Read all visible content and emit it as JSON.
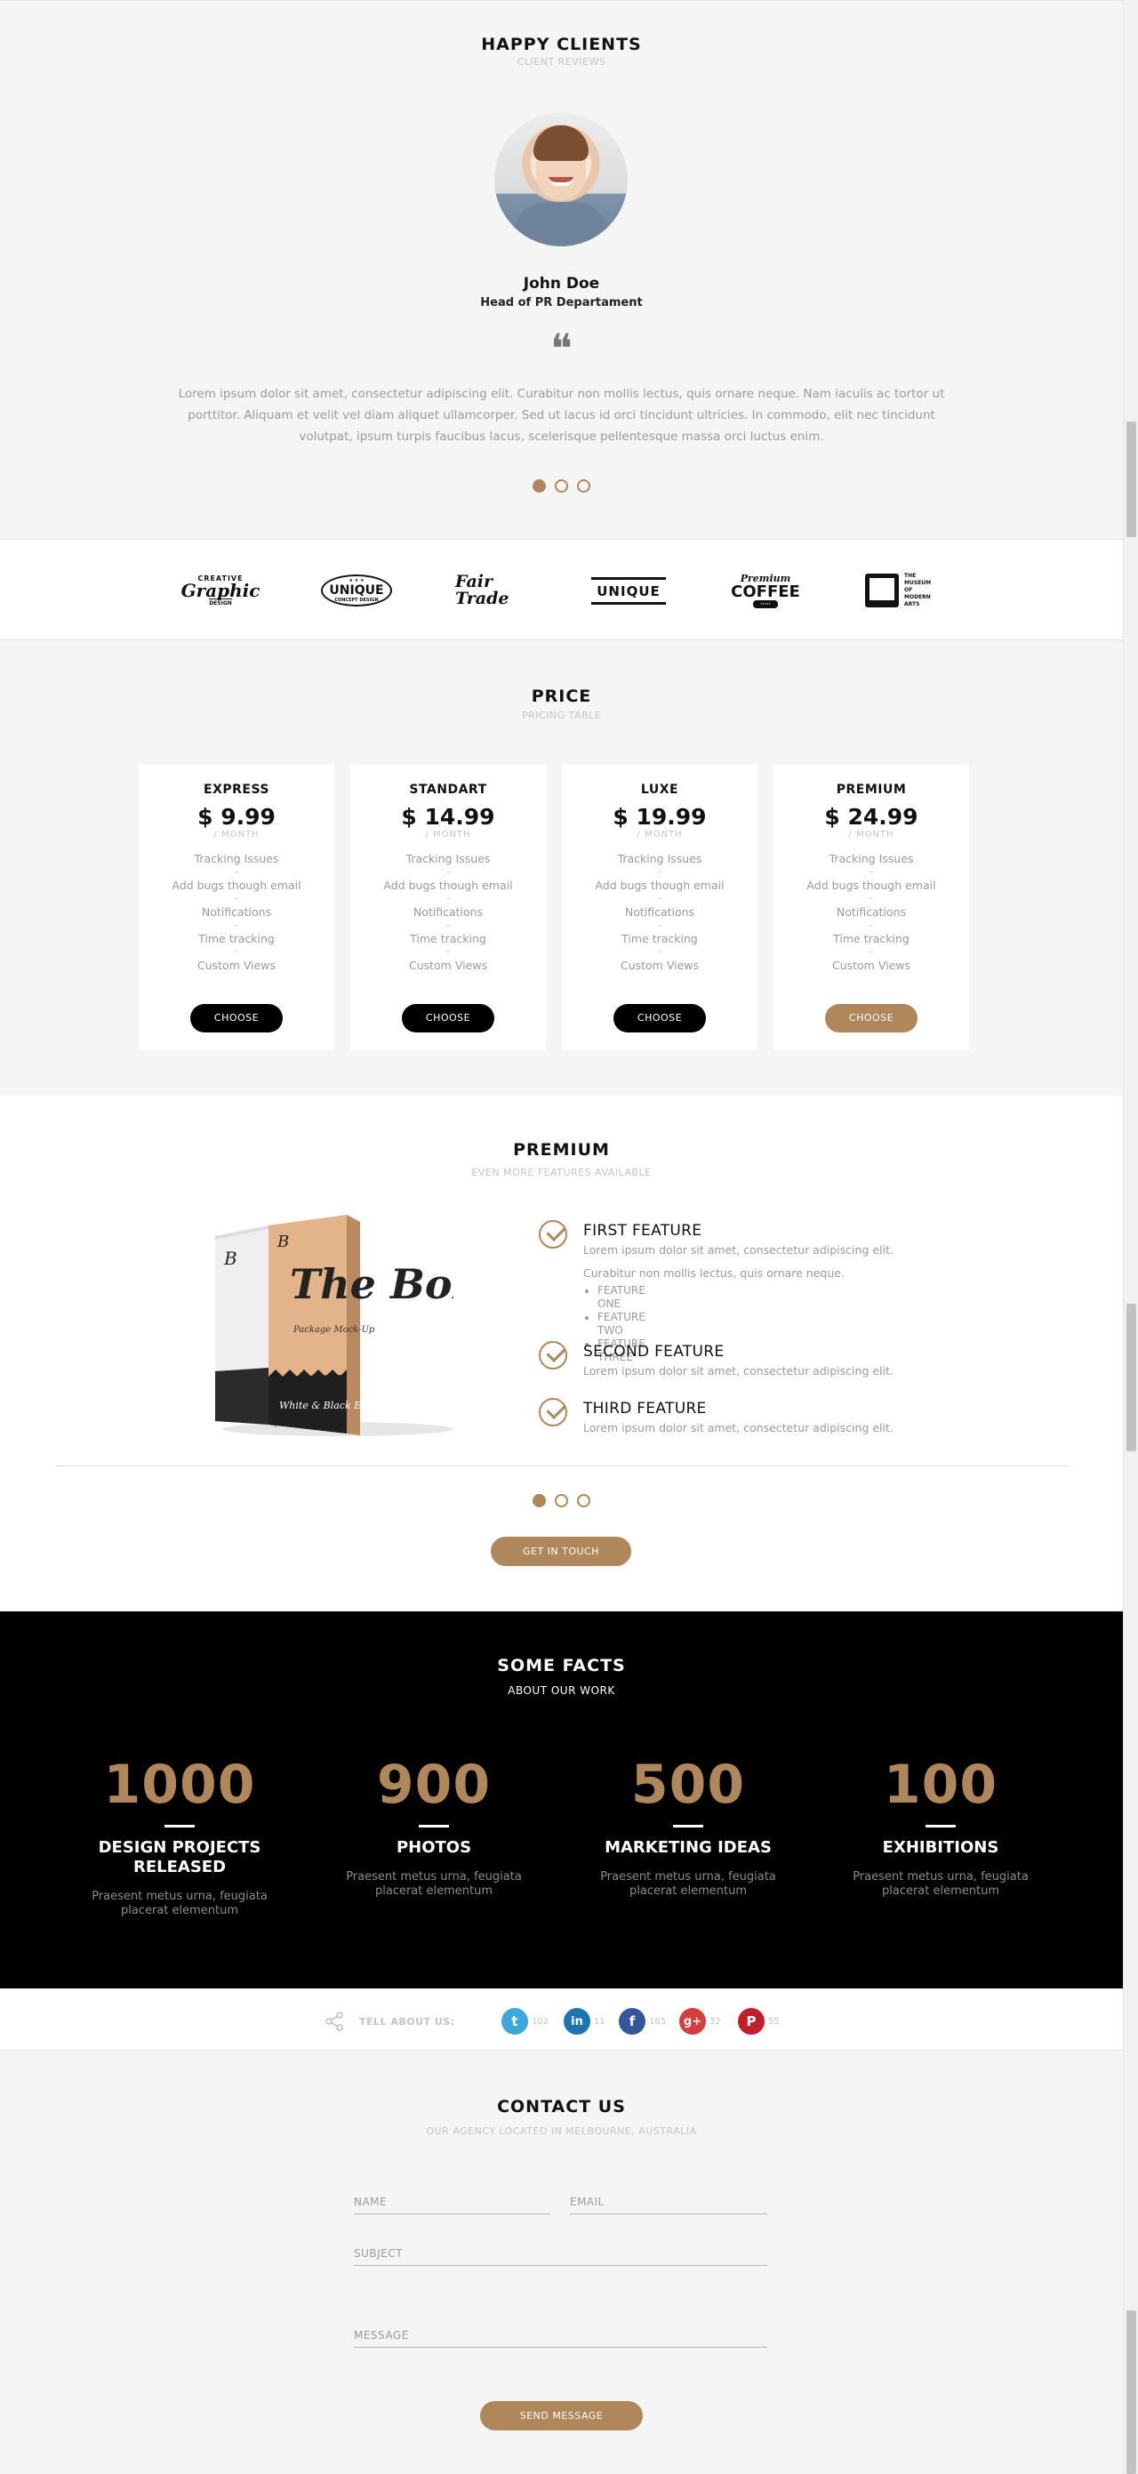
{
  "clients": {
    "title": "HAPPY CLIENTS",
    "subtitle": "CLIENT REVIEWS",
    "name": "John Doe",
    "role": "Head of PR Departament",
    "quote_mark": "❝",
    "quote": "Lorem ipsum dolor sit amet, consectetur adipiscing elit. Curabitur non mollis lectus, quis ornare neque. Nam iaculis ac tortor ut porttitor. Aliquam et velit vel diam aliquet ullamcorper. Sed ut lacus id orci tincidunt ultricies. In commodo, elit nec tincidunt volutpat, ipsum turpis faucibus lacus, scelerisque pellentesque massa orci luctus enim.",
    "slider_active": 1,
    "slider_count": 3
  },
  "logos": [
    {
      "text": "Graphic",
      "small": "CREATIVE · DESIGN"
    },
    {
      "text": "UNIQUE",
      "small": "CONCEPT DESIGN"
    },
    {
      "text": "Fair Trade",
      "small": ""
    },
    {
      "text": "UNIQUE",
      "small": ""
    },
    {
      "text": "COFFEE",
      "small": "Premium"
    },
    {
      "text": "THE MUSEUM OF MODERN ARTS",
      "small": ""
    }
  ],
  "pricing": {
    "title": "PRICE",
    "subtitle": "PRICING TABLE",
    "plans": [
      {
        "name": "EXPRESS",
        "price": "$ 9.99",
        "period": "/ MONTH",
        "button": "CHOOSE"
      },
      {
        "name": "STANDART",
        "price": "$ 14.99",
        "period": "/ MONTH",
        "button": "CHOOSE"
      },
      {
        "name": "LUXE",
        "price": "$ 19.99",
        "period": "/ MONTH",
        "button": "CHOOSE"
      },
      {
        "name": "PREMIUM",
        "price": "$ 24.99",
        "period": "/ MONTH",
        "button": "CHOOSE"
      }
    ],
    "features": [
      "Tracking Issues",
      "Add bugs though email",
      "Notifications",
      "Time tracking",
      "Custom Views"
    ],
    "separator": "–"
  },
  "premium": {
    "title": "PREMIUM",
    "subtitle": "EVEN MORE FEATURES AVAILABLE",
    "box_title": "The Box",
    "box_sub": "Package Mock-Up",
    "box_footer": "White & Black Edition",
    "features": [
      {
        "title": "FIRST FEATURE",
        "text": "Lorem ipsum dolor sit amet, consectetur adipiscing elit.",
        "extra": "Curabitur non mollis lectus, quis ornare neque.",
        "list": [
          "FEATURE ONE",
          "FEATURE TWO",
          "FEATURE THREE"
        ]
      },
      {
        "title": "SECOND FEATURE",
        "text": "Lorem ipsum dolor sit amet, consectetur adipiscing elit."
      },
      {
        "title": "THIRD FEATURE",
        "text": "Lorem ipsum dolor sit amet, consectetur adipiscing elit."
      }
    ],
    "button": "GET IN TOUCH"
  },
  "facts": {
    "title": "SOME FACTS",
    "subtitle": "ABOUT OUR WORK",
    "items": [
      {
        "num": "1000",
        "label": "DESIGN PROJECTS RELEASED",
        "desc": "Praesent metus urna, feugiata placerat elementum"
      },
      {
        "num": "900",
        "label": "PHOTOS",
        "desc": "Praesent metus urna, feugiata placerat elementum"
      },
      {
        "num": "500",
        "label": "MARKETING IDEAS",
        "desc": "Praesent metus urna, feugiata placerat elementum"
      },
      {
        "num": "100",
        "label": "EXHIBITIONS",
        "desc": "Praesent metus urna, feugiata placerat elementum"
      }
    ]
  },
  "share": {
    "label": "TELL ABOUT US:",
    "networks": [
      {
        "name": "twitter",
        "glyph": "t",
        "count": "102",
        "color": "#3ea8dd"
      },
      {
        "name": "linkedin",
        "glyph": "in",
        "count": "11",
        "color": "#1c75b1"
      },
      {
        "name": "facebook",
        "glyph": "f",
        "count": "165",
        "color": "#34569c"
      },
      {
        "name": "google-plus",
        "glyph": "g+",
        "count": "32",
        "color": "#d63e3d"
      },
      {
        "name": "pinterest",
        "glyph": "P",
        "count": "55",
        "color": "#c31f2a"
      }
    ]
  },
  "contact": {
    "title": "CONTACT US",
    "subtitle": "OUR AGENCY LOCATED IN MELBOURNE, AUSTRALIA",
    "name_placeholder": "NAME",
    "email_placeholder": "EMAIL",
    "subject_placeholder": "SUBJECT",
    "message_placeholder": "MESSAGE",
    "button": "SEND MESSAGE"
  },
  "colors": {
    "accent": "#b0875a",
    "dark": "#000000"
  }
}
